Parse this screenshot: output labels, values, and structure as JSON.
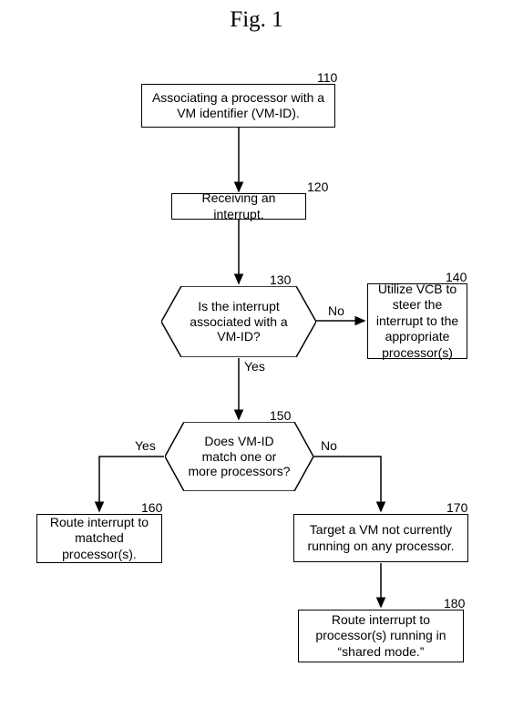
{
  "title": "Fig. 1",
  "nodes": {
    "n110": {
      "ref": "110",
      "text": "Associating a processor with a\nVM identifier (VM-ID)."
    },
    "n120": {
      "ref": "120",
      "text": "Receiving an interrupt."
    },
    "n130": {
      "ref": "130",
      "text": "Is the interrupt\nassociated with a\nVM-ID?"
    },
    "n140": {
      "ref": "140",
      "text": "Utilize VCB to\nsteer the\ninterrupt to the\nappropriate\nprocessor(s)"
    },
    "n150": {
      "ref": "150",
      "text": "Does VM-ID\nmatch one or\nmore processors?"
    },
    "n160": {
      "ref": "160",
      "text": "Route interrupt to\nmatched\nprocessor(s)."
    },
    "n170": {
      "ref": "170",
      "text": "Target a VM not currently\nrunning on any processor."
    },
    "n180": {
      "ref": "180",
      "text": "Route interrupt to\nprocessor(s) running in\n“shared mode.”"
    }
  },
  "edges": {
    "n130_yes": "Yes",
    "n130_no": "No",
    "n150_yes": "Yes",
    "n150_no": "No"
  }
}
